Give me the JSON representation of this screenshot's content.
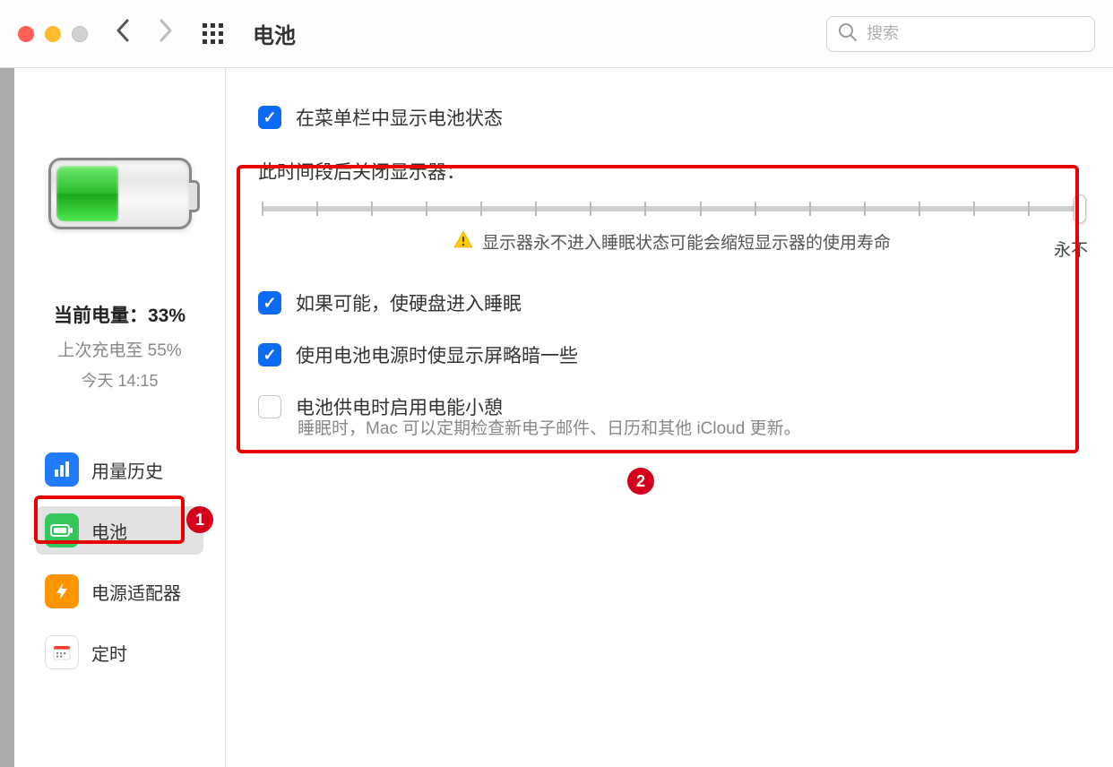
{
  "header": {
    "title": "电池",
    "search_placeholder": "搜索"
  },
  "sidebar": {
    "current_level_label": "当前电量：33%",
    "last_charge_label": "上次充电至 55%",
    "last_charge_time": "今天 14:15",
    "items": [
      {
        "label": "用量历史"
      },
      {
        "label": "电池"
      },
      {
        "label": "电源适配器"
      },
      {
        "label": "定时"
      }
    ]
  },
  "main": {
    "show_in_menubar_label": "在菜单栏中显示电池状态",
    "slider_label": "此时间段后关闭显示器：",
    "slider_end_label": "永不",
    "warning_text": "显示器永不进入睡眠状态可能会缩短显示器的使用寿命",
    "options": [
      {
        "label": "如果可能，使硬盘进入睡眠",
        "checked": true
      },
      {
        "label": "使用电池电源时使显示屏略暗一些",
        "checked": true
      },
      {
        "label": "电池供电时启用电能小憩",
        "checked": false
      }
    ],
    "power_nap_sub": "睡眠时，Mac 可以定期检查新电子邮件、日历和其他 iCloud 更新。"
  },
  "annotations": {
    "badge1": "1",
    "badge2": "2"
  }
}
